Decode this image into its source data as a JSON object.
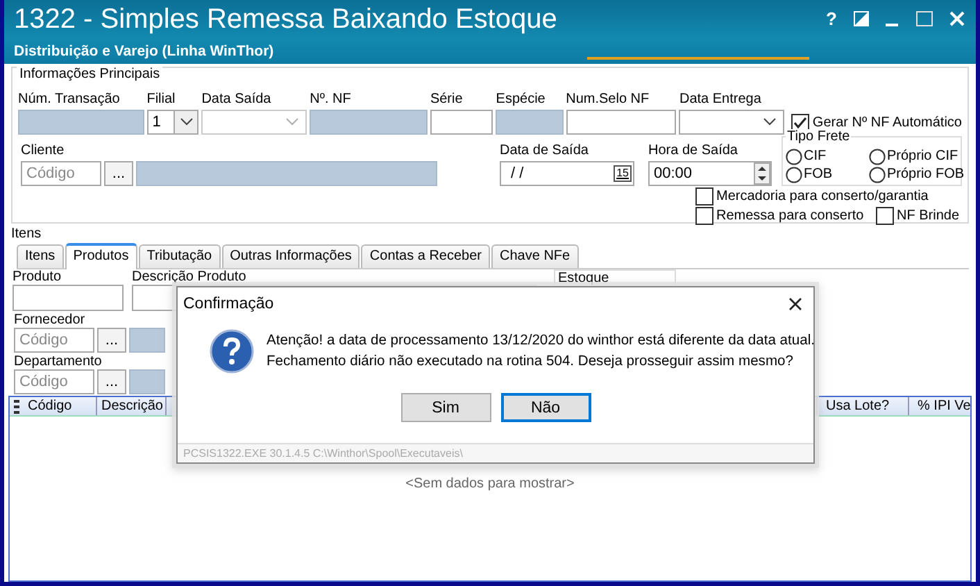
{
  "window": {
    "title": "1322 - Simples Remessa Baixando Estoque",
    "subtitle": "Distribuição e Varejo (Linha WinThor)",
    "help": "?"
  },
  "main_info": {
    "title": "Informações Principais",
    "fields": [
      {
        "label": "Núm. Transação",
        "kind": "readonly"
      },
      {
        "label": "Filial",
        "kind": "select",
        "value": "1"
      },
      {
        "label": "Data Saída",
        "kind": "combo",
        "disabled": true
      },
      {
        "label": "Nº. NF",
        "kind": "readonly"
      },
      {
        "label": "Série",
        "kind": "text"
      },
      {
        "label": "Espécie",
        "kind": "readonly"
      },
      {
        "label": "Num.Selo NF",
        "kind": "text"
      },
      {
        "label": "Data Entrega",
        "kind": "combo",
        "disabled": false
      }
    ],
    "auto_nf": {
      "label": "Gerar Nº NF Automático",
      "checked": true
    },
    "cliente": {
      "label": "Cliente",
      "placeholder": "Código",
      "lookup": "..."
    },
    "data_saida": {
      "label": "Data de Saída",
      "value": "/ /",
      "calendar": "15"
    },
    "hora_saida": {
      "label": "Hora de Saída",
      "value": "00:00"
    },
    "tipo_frete": {
      "title": "Tipo Frete",
      "options": [
        {
          "label": "CIF",
          "selected": false
        },
        {
          "label": "FOB",
          "selected": false
        },
        {
          "label": "Próprio CIF",
          "selected": false
        },
        {
          "label": "Próprio FOB",
          "selected": false
        }
      ]
    },
    "checkboxes": [
      {
        "label": "Mercadoria para conserto/garantia",
        "checked": false
      },
      {
        "label": "Remessa para conserto",
        "checked": false
      },
      {
        "label": "NF Brinde",
        "checked": false
      }
    ]
  },
  "items": {
    "title": "Itens",
    "tabs": [
      {
        "label": "Itens",
        "selected": false
      },
      {
        "label": "Produtos",
        "selected": true
      },
      {
        "label": "Tributação",
        "selected": false
      },
      {
        "label": "Outras Informações",
        "selected": false
      },
      {
        "label": "Contas a Receber",
        "selected": false
      },
      {
        "label": "Chave NFe",
        "selected": false
      }
    ],
    "produto": {
      "label": "Produto"
    },
    "descricao": {
      "label": "Descrição Produto"
    },
    "estoque": {
      "label": "Estoque"
    },
    "lookups": [
      {
        "label": "Fornecedor",
        "placeholder": "Código",
        "lookup": "..."
      },
      {
        "label": "Departamento",
        "placeholder": "Código",
        "lookup": "..."
      }
    ],
    "grid": {
      "columns": [
        "Código",
        "Descrição",
        "Usa Lote?",
        "% IPI Ve"
      ],
      "empty_text": "<Sem dados para mostrar>"
    }
  },
  "dialog": {
    "title": "Confirmação",
    "message_lines": [
      "Atenção! a data de processamento 13/12/2020 do winthor está diferente da data atual.",
      "Fechamento diário não executado na rotina 504. Deseja prosseguir assim mesmo?"
    ],
    "buttons": [
      {
        "label": "Sim",
        "focused": false
      },
      {
        "label": "Não",
        "focused": true
      }
    ],
    "footer": "PCSIS1322.EXE 30.1.4.5 C:\\Winthor\\Spool\\Executaveis\\"
  }
}
